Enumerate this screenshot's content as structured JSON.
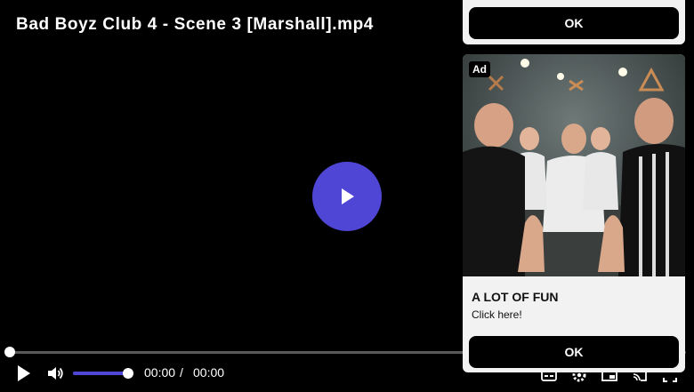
{
  "video": {
    "title": "Bad Boyz Club 4 - Scene 3 [Marshall].mp4",
    "current_time": "00:00",
    "separator": "/",
    "duration": "00:00",
    "progress": 0,
    "volume": 1.0,
    "accent_color": "#5046d6"
  },
  "icons": {
    "big_play": "play-icon",
    "play": "play-icon",
    "volume": "volume-icon",
    "subtitles": "captions-icon",
    "settings": "gear-icon",
    "pip": "picture-in-picture-icon",
    "cast": "cast-icon",
    "fullscreen": "fullscreen-icon"
  },
  "ad_top": {
    "ok_label": "OK"
  },
  "ad": {
    "badge": "Ad",
    "headline": "A LOT OF FUN",
    "subtext": "Click here!",
    "ok_label": "OK"
  }
}
